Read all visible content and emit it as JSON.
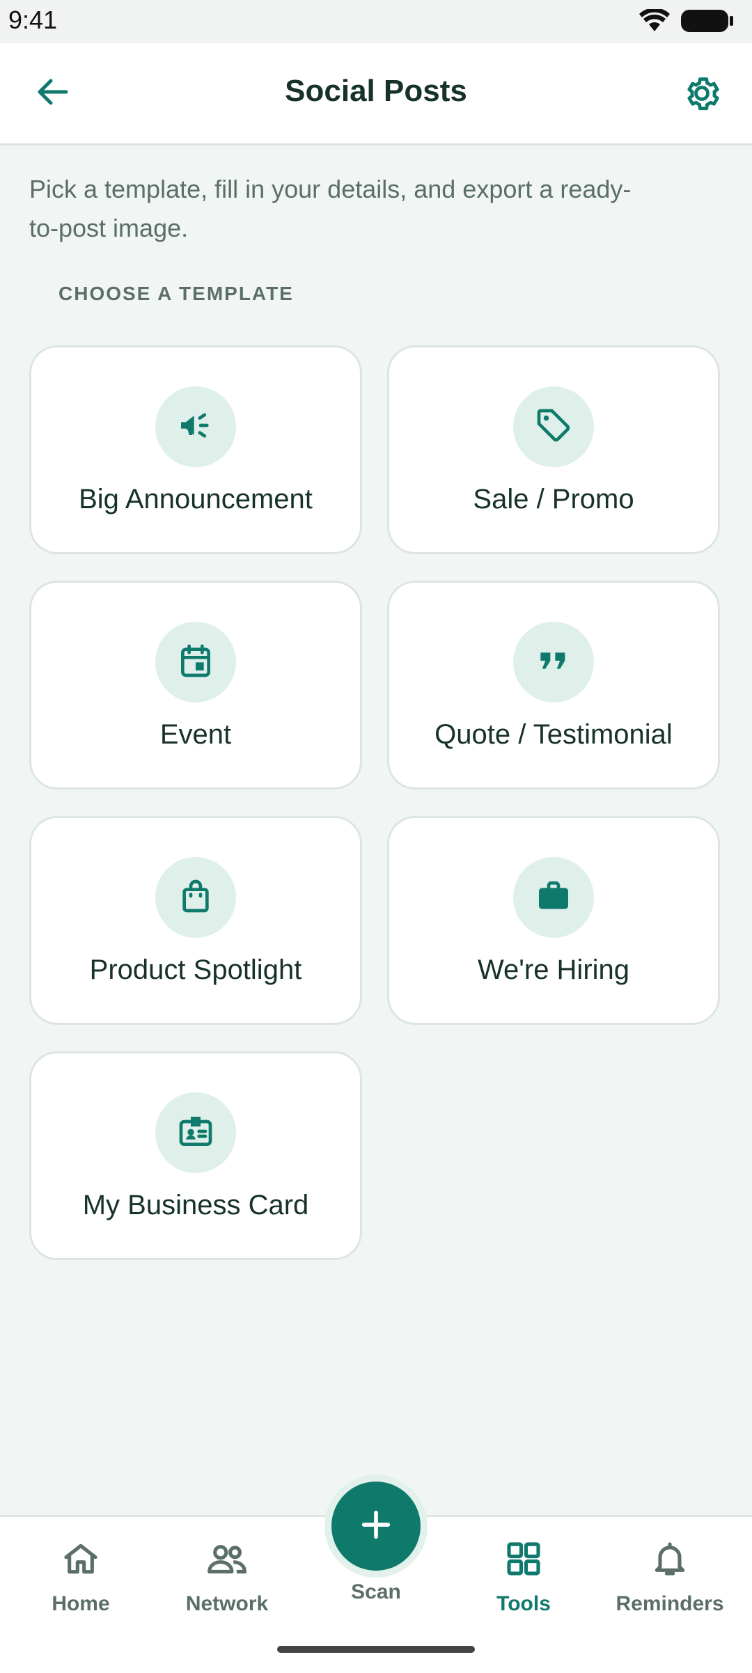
{
  "status": {
    "time": "9:41"
  },
  "header": {
    "title": "Social Posts"
  },
  "intro_text": "Pick a template, fill in your details, and export a ready-to-post image.",
  "section_label": "CHOOSE A TEMPLATE",
  "templates": [
    {
      "label": "Big Announcement",
      "icon": "megaphone-icon"
    },
    {
      "label": "Sale / Promo",
      "icon": "tag-icon"
    },
    {
      "label": "Event",
      "icon": "calendar-icon"
    },
    {
      "label": "Quote / Testimonial",
      "icon": "quote-icon"
    },
    {
      "label": "Product Spotlight",
      "icon": "shopping-bag-icon"
    },
    {
      "label": "We're Hiring",
      "icon": "briefcase-icon"
    },
    {
      "label": "My Business Card",
      "icon": "id-badge-icon"
    }
  ],
  "bottom_nav": {
    "items": [
      {
        "label": "Home",
        "icon": "home-icon"
      },
      {
        "label": "Network",
        "icon": "people-icon"
      },
      {
        "label": "Scan",
        "icon": "plus-icon"
      },
      {
        "label": "Tools",
        "icon": "grid-icon",
        "active": true
      },
      {
        "label": "Reminders",
        "icon": "bell-icon"
      }
    ]
  },
  "colors": {
    "accent": "#0f7a6c",
    "icon_bg": "#dff0eb",
    "background": "#f1f6f4"
  }
}
